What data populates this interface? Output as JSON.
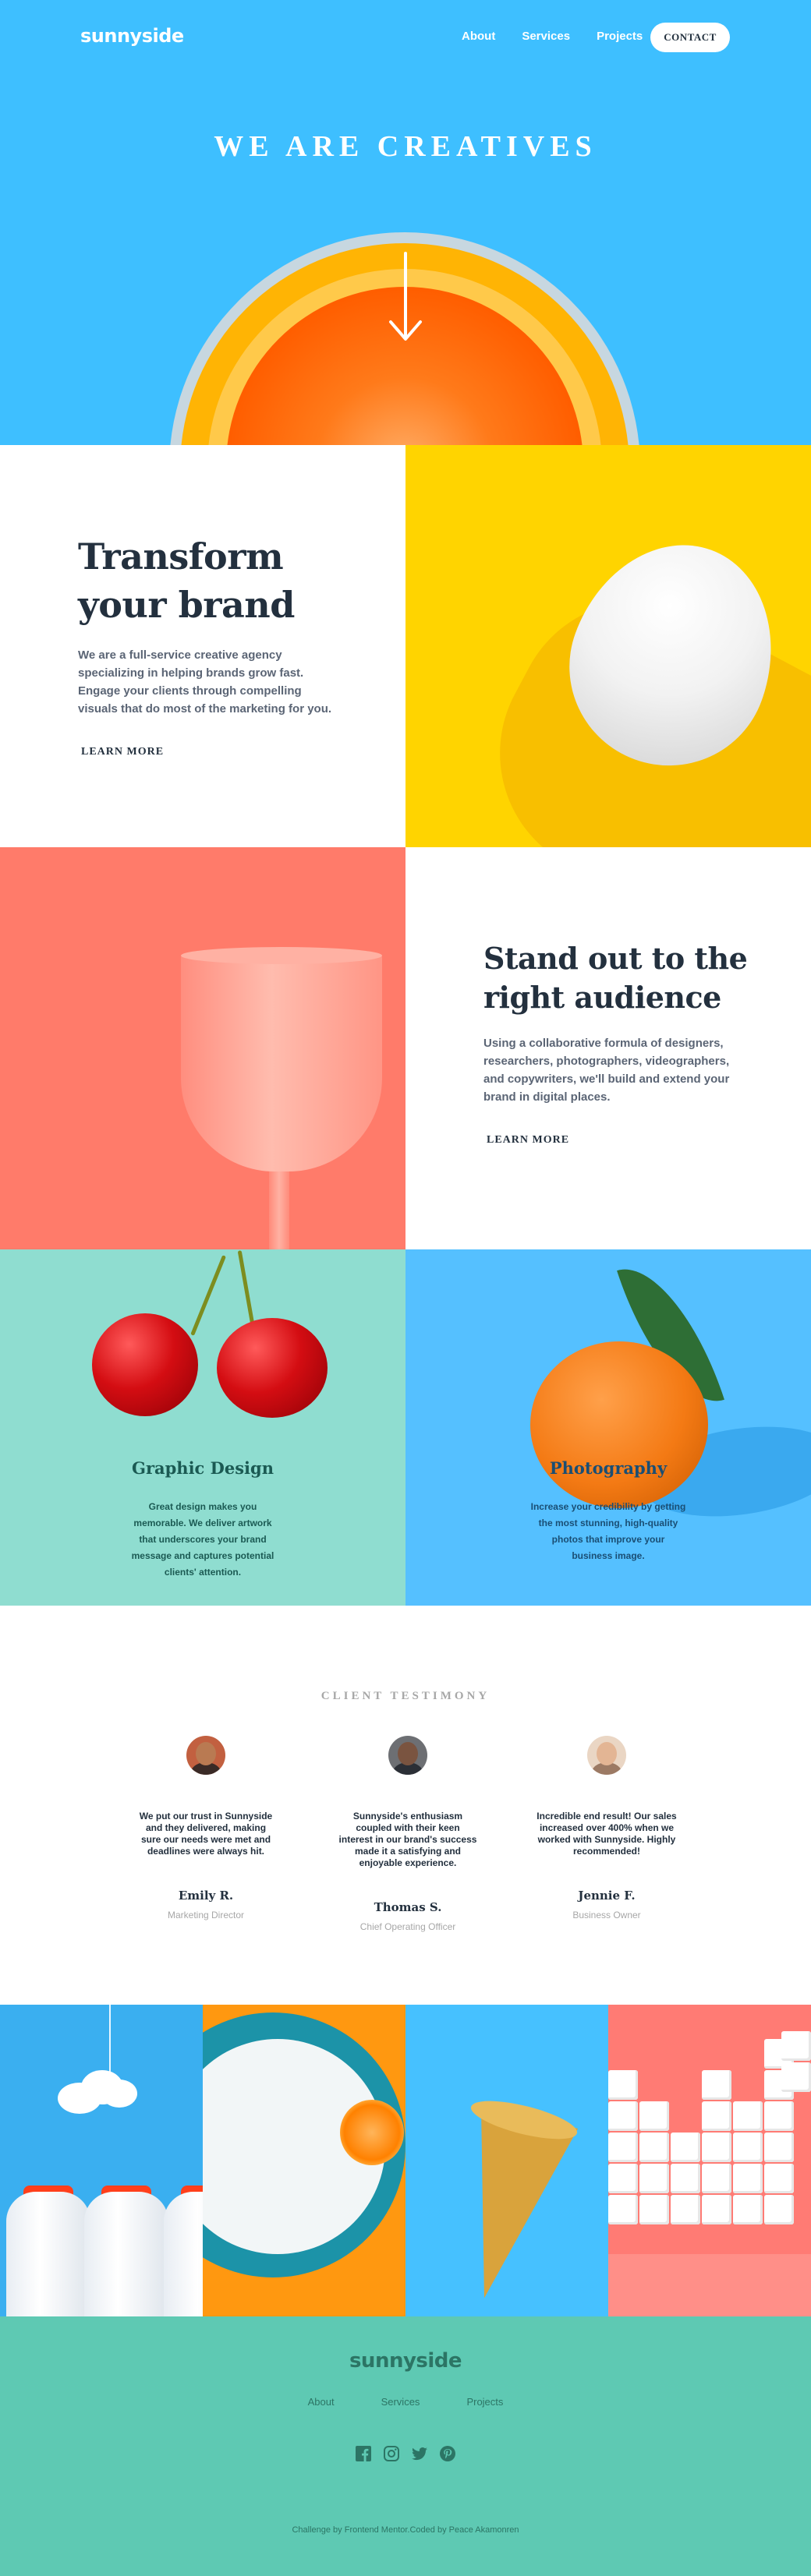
{
  "header": {
    "logo": "sunnyside",
    "nav": [
      "About",
      "Services",
      "Projects"
    ],
    "contact_label": "CONTACT"
  },
  "hero": {
    "title": "WE ARE CREATIVES",
    "arrow_icon": "arrow-down-icon"
  },
  "transform": {
    "title_line1": "Transform",
    "title_line2": "your brand",
    "body": "We are a full-service creative agency specializing in helping brands grow fast. Engage your clients through compelling visuals that do most of the marketing for you.",
    "link": "LEARN MORE",
    "accent": "#fad400"
  },
  "standout": {
    "title_line1": "Stand out to the",
    "title_line2": "right audience",
    "body": "Using a collaborative formula of designers, researchers, photographers, videographers, and copywriters, we'll build and extend your brand in digital places.",
    "link": "LEARN MORE",
    "accent": "#fe7766"
  },
  "services": [
    {
      "title": "Graphic Design",
      "text": "Great design makes you memorable. We deliver artwork that underscores your brand message and captures potential clients' attention."
    },
    {
      "title": "Photography",
      "text": "Increase your credibility by getting the most stunning, high-quality photos that improve your business image."
    }
  ],
  "testimonials": {
    "title": "CLIENT TESTIMONY",
    "items": [
      {
        "quote": "We put our trust in Sunnyside and they delivered, making sure our needs were met and deadlines were always hit.",
        "name": "Emily R.",
        "role": "Marketing Director"
      },
      {
        "quote": "Sunnyside's enthusiasm coupled with their keen interest in our brand's success made it a satisfying and enjoyable experience.",
        "name": "Thomas S.",
        "role": "Chief Operating Officer"
      },
      {
        "quote": "Incredible end result! Our sales increased over 400% when we worked with Sunnyside. Highly recommended!",
        "name": "Jennie F.",
        "role": "Business Owner"
      }
    ]
  },
  "footer": {
    "logo": "sunnyside",
    "links": [
      "About",
      "Services",
      "Projects"
    ],
    "social": [
      "facebook-icon",
      "instagram-icon",
      "twitter-icon",
      "pinterest-icon"
    ],
    "attribution": "Challenge by Frontend Mentor.Coded by Peace Akamonren"
  },
  "colors": {
    "hero_blue": "#3ebfff",
    "yellow": "#ffd400",
    "coral": "#ff7b6a",
    "mint": "#8fddd0",
    "footer_green": "#5ec9b3",
    "dark_text": "#23303e"
  }
}
